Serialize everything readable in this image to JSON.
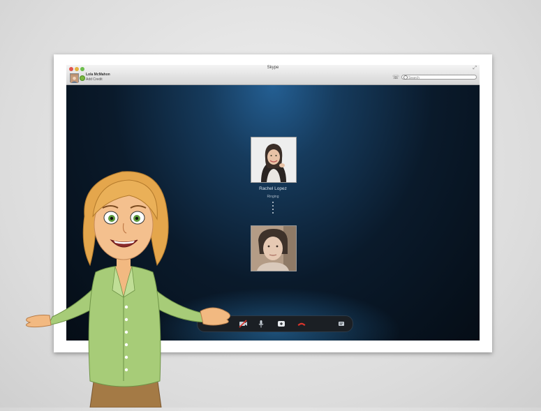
{
  "window": {
    "title": "Skype",
    "expand_icon": "fullscreen-arrows-icon"
  },
  "account": {
    "name": "Lola McMahon",
    "credit_link": "Add Credit",
    "status": "online"
  },
  "search": {
    "placeholder": "Search"
  },
  "call": {
    "contact_name": "Rachel Lopez",
    "status": "Ringing"
  },
  "controls": [
    {
      "name": "video-off-icon"
    },
    {
      "name": "microphone-icon"
    },
    {
      "name": "add-icon"
    },
    {
      "name": "hang-up-icon"
    },
    {
      "name": "chat-icon"
    }
  ],
  "colors": {
    "hangup": "#d9342b",
    "presence": "#7ab73f",
    "call_background": "#0a1a2b"
  }
}
